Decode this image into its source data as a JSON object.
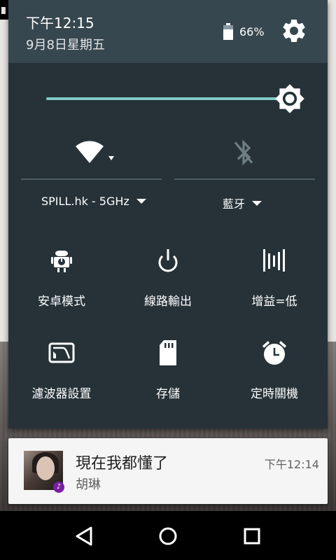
{
  "status": {
    "time": "下午12:15",
    "date": "9月8日星期五",
    "battery": "66%"
  },
  "brightness": {
    "level": 1.0
  },
  "wifi": {
    "network": "SPILL.hk - 5GHz"
  },
  "bluetooth": {
    "label": "藍牙"
  },
  "tiles": [
    {
      "label": "安卓模式",
      "icon": "android-icon"
    },
    {
      "label": "線路輸出",
      "icon": "power-icon"
    },
    {
      "label": "增益=低",
      "icon": "gain-bars-icon"
    },
    {
      "label": "濾波器設置",
      "icon": "filter-icon"
    },
    {
      "label": "存儲",
      "icon": "sd-card-icon"
    },
    {
      "label": "定時關機",
      "icon": "alarm-icon"
    }
  ],
  "notification": {
    "title": "現在我都懂了",
    "artist": "胡琳",
    "time": "下午12:14"
  },
  "colors": {
    "panel": "#263238",
    "header": "#37474f",
    "accent": "#80cbc4"
  }
}
